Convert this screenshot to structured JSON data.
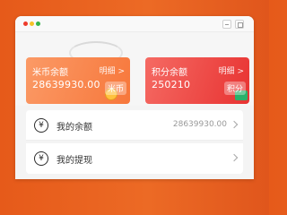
{
  "window": {
    "controls": [
      "close-dot",
      "minimize-dot",
      "zoom-dot"
    ]
  },
  "cards": {
    "coin": {
      "title": "米币余额",
      "detail": "明细 >",
      "value": "28639930.00",
      "badge": "米币",
      "color": "#f7773b"
    },
    "points": {
      "title": "积分余额",
      "detail": "明细 >",
      "value": "250210",
      "badge": "积分",
      "color": "#e83332"
    }
  },
  "list": {
    "balance": {
      "icon": "yuan-coin-icon",
      "icon_glyph": "¥",
      "label": "我的余额",
      "value": "28639930.00"
    },
    "withdraw": {
      "icon": "yuan-coin-icon",
      "icon_glyph": "¥",
      "label": "我的提现"
    }
  },
  "colors": {
    "brand": "#e8601f"
  }
}
